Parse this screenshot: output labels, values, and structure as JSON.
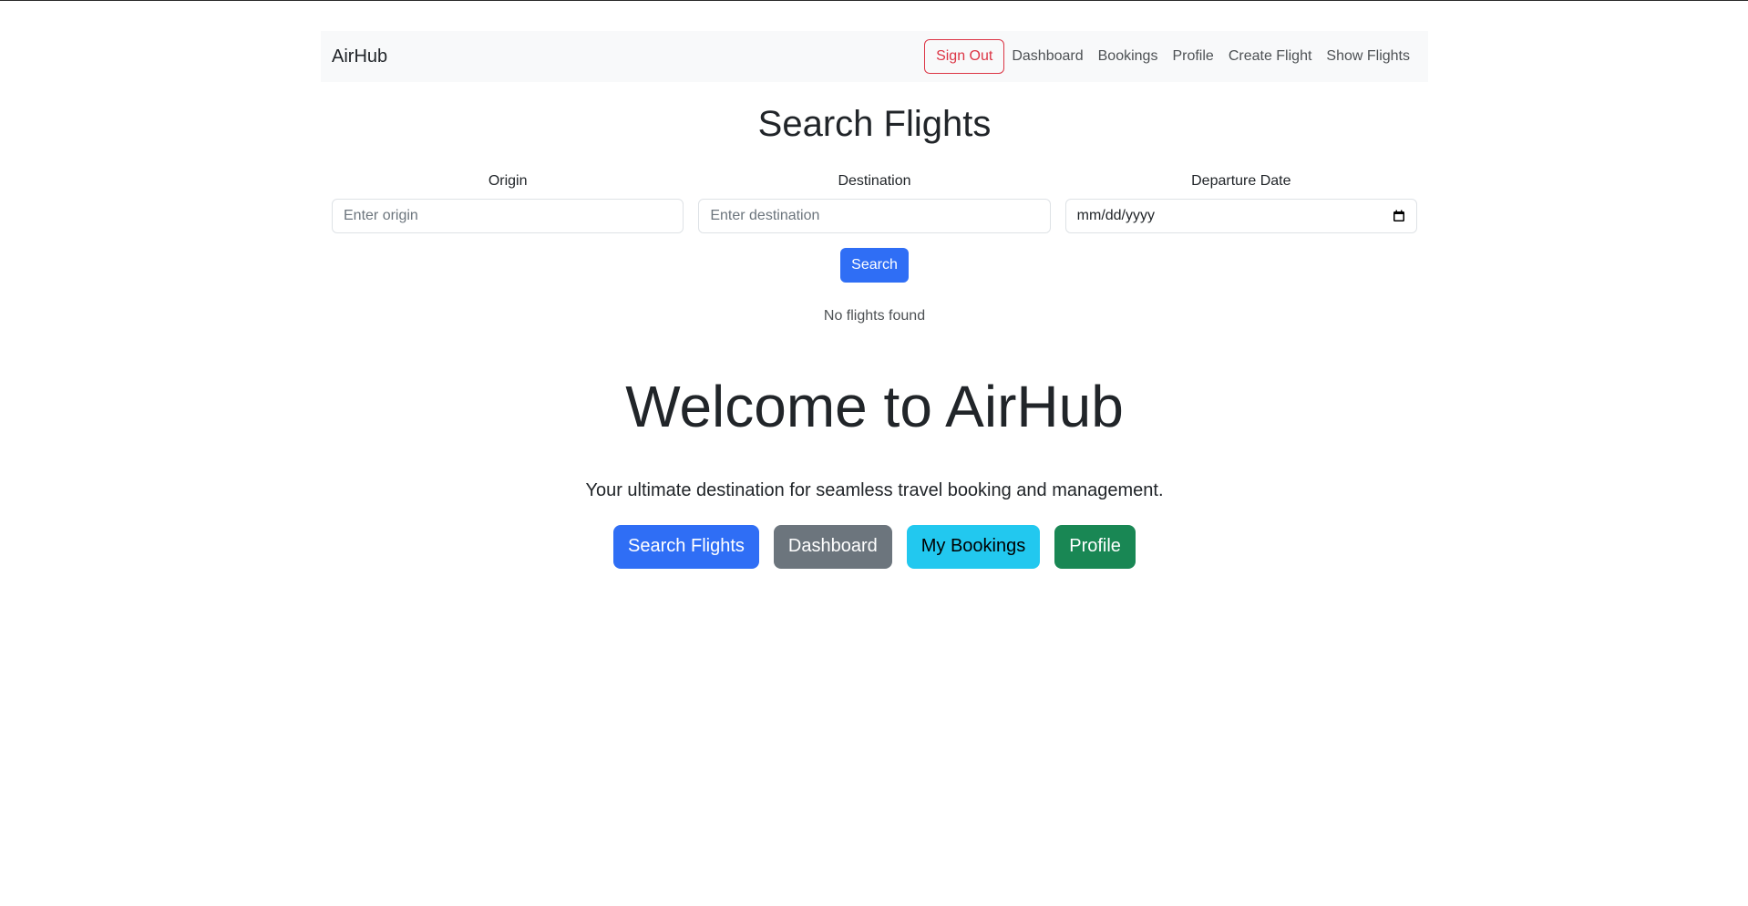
{
  "navbar": {
    "brand": "AirHub",
    "signout_label": "Sign Out",
    "links": [
      "Dashboard",
      "Bookings",
      "Profile",
      "Create Flight",
      "Show Flights"
    ]
  },
  "search": {
    "title": "Search Flights",
    "origin_label": "Origin",
    "origin_placeholder": "Enter origin",
    "destination_label": "Destination",
    "destination_placeholder": "Enter destination",
    "date_label": "Departure Date",
    "date_placeholder": "mm/dd/yyyy",
    "button_label": "Search",
    "result_text": "No flights found"
  },
  "hero": {
    "title": "Welcome to AirHub",
    "subtitle": "Your ultimate destination for seamless travel booking and management.",
    "buttons": [
      "Search Flights",
      "Dashboard",
      "My Bookings",
      "Profile"
    ]
  },
  "colors": {
    "primary": "#2f6ef5",
    "secondary": "#6c757d",
    "info": "#22c8ef",
    "success": "#198754",
    "danger": "#dc3545"
  }
}
